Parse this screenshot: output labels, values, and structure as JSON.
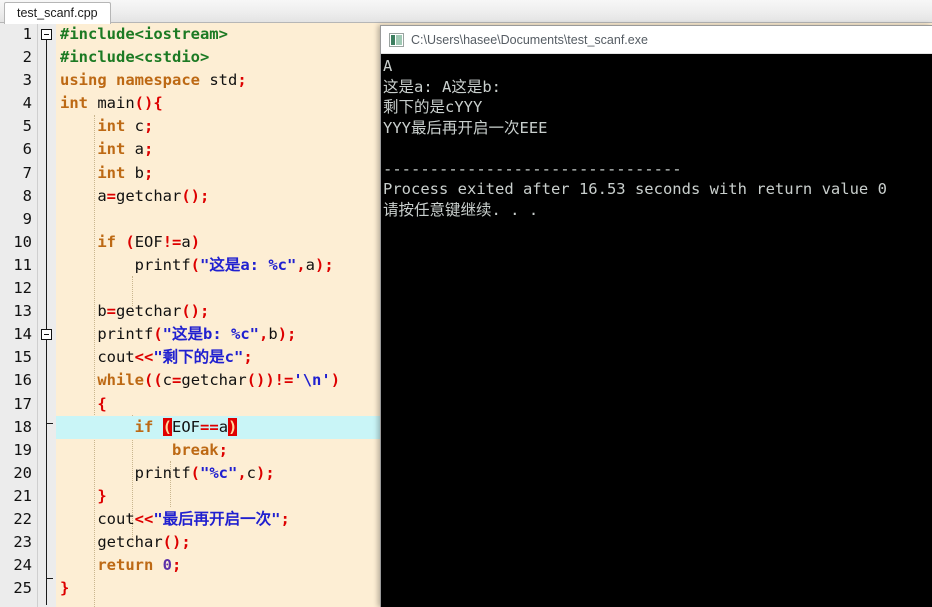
{
  "ide": {
    "tab": {
      "label": "test_scanf.cpp"
    },
    "editor": {
      "highlighted_line": 18,
      "colors": {
        "background": "#fdeed4",
        "gutter": "#ececec",
        "current_line": "#c9f5f7",
        "keyword": "#bd6914",
        "preprocessor": "#1c7a23",
        "string": "#2020d0",
        "punctuation": "#dd0000",
        "number": "#5b2fa8",
        "bracket_match": "#e00000"
      },
      "lines": [
        {
          "n": 1,
          "text": "#include<iostream>"
        },
        {
          "n": 2,
          "text": "#include<cstdio>"
        },
        {
          "n": 3,
          "text": "using namespace std;"
        },
        {
          "n": 4,
          "text": "int main(){"
        },
        {
          "n": 5,
          "text": "    int c;"
        },
        {
          "n": 6,
          "text": "    int a;"
        },
        {
          "n": 7,
          "text": "    int b;"
        },
        {
          "n": 8,
          "text": "    a=getchar();"
        },
        {
          "n": 9,
          "text": ""
        },
        {
          "n": 10,
          "text": "    if (EOF!=a)"
        },
        {
          "n": 11,
          "text": "        printf(\"这是a: %c\",a);"
        },
        {
          "n": 12,
          "text": ""
        },
        {
          "n": 13,
          "text": "    b=getchar();"
        },
        {
          "n": 14,
          "text": "    printf(\"这是b: %c\",b);"
        },
        {
          "n": 15,
          "text": "    cout<<\"剩下的是c\";"
        },
        {
          "n": 16,
          "text": "    while((c=getchar())!='\\n')"
        },
        {
          "n": 17,
          "text": "    {"
        },
        {
          "n": 18,
          "text": "        if (EOF==a)"
        },
        {
          "n": 19,
          "text": "            break;"
        },
        {
          "n": 20,
          "text": "        printf(\"%c\",c);"
        },
        {
          "n": 21,
          "text": "    }"
        },
        {
          "n": 22,
          "text": "    cout<<\"最后再开启一次\";"
        },
        {
          "n": 23,
          "text": "    getchar();"
        },
        {
          "n": 24,
          "text": "    return 0;"
        },
        {
          "n": 25,
          "text": "}"
        }
      ]
    }
  },
  "console": {
    "title": "C:\\Users\\hasee\\Documents\\test_scanf.exe",
    "icon": "console-window-icon",
    "output": [
      "A",
      "这是a: A这是b: ",
      "剩下的是cYYY",
      "YYY最后再开启一次EEE",
      "",
      "--------------------------------",
      "Process exited after 16.53 seconds with return value 0",
      "请按任意键继续. . ."
    ]
  }
}
